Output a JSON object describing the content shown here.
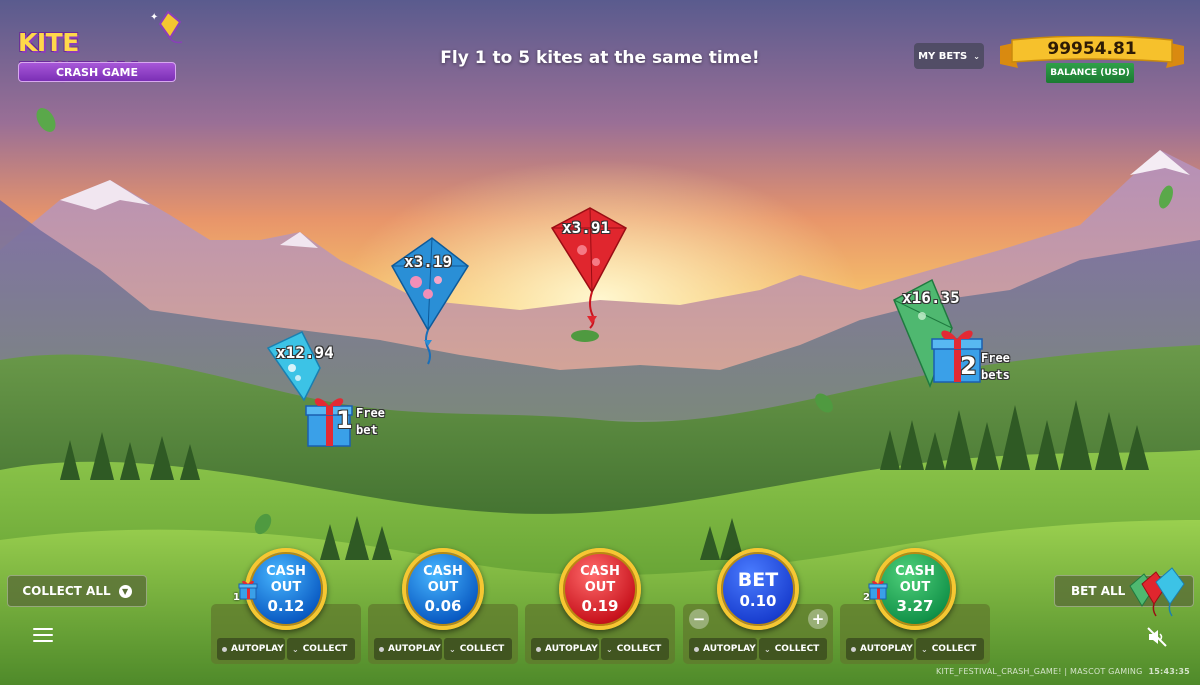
{
  "logo": {
    "title": "KITE FESTIVAL",
    "subtitle": "CRASH GAME"
  },
  "header": {
    "tagline": "Fly 1 to 5 kites at the same time!",
    "my_bets_label": "MY BETS",
    "balance_amount": "99954.81",
    "balance_label": "BALANCE (USD)"
  },
  "kites": [
    {
      "multiplier": "x12.94",
      "color": "#35b9e0",
      "free_bets_count": "1",
      "free_bets_text": "Free",
      "free_bets_text2": "bet"
    },
    {
      "multiplier": "x3.19",
      "color": "#2a8fd6"
    },
    {
      "multiplier": "x3.91",
      "color": "#e0262e"
    },
    {
      "multiplier": "x16.35",
      "color": "#4fb870",
      "free_bets_count": "2",
      "free_bets_text": "Free",
      "free_bets_text2": "bets"
    }
  ],
  "controls": {
    "collect_all_label": "COLLECT ALL",
    "bet_all_label": "BET ALL",
    "autoplay_label": "AUTOPLAY",
    "collect_label": "COLLECT",
    "slots": [
      {
        "line1": "CASH",
        "line2": "OUT",
        "value": "0.12",
        "color": "blue",
        "gift_badge": "1"
      },
      {
        "line1": "CASH",
        "line2": "OUT",
        "value": "0.06",
        "color": "blue"
      },
      {
        "line1": "CASH",
        "line2": "OUT",
        "value": "0.19",
        "color": "red"
      },
      {
        "line1": "BET",
        "line2": "",
        "value": "0.10",
        "color": "navy",
        "minus": "−",
        "plus": "+"
      },
      {
        "line1": "CASH",
        "line2": "OUT",
        "value": "3.27",
        "color": "green",
        "gift_badge": "2"
      }
    ]
  },
  "footer": {
    "info": "KITE_FESTIVAL_CRASH_GAME! | MASCOT GAMING",
    "time": "15:43:35"
  }
}
